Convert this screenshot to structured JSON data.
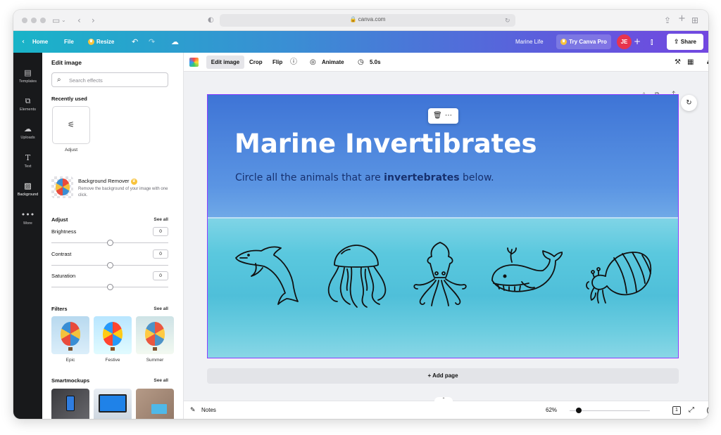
{
  "browser": {
    "url": "canva.com"
  },
  "header": {
    "home_label": "Home",
    "file_label": "File",
    "resize_label": "Resize",
    "project_name": "Marine Life",
    "try_pro_label": "Try Canva Pro",
    "avatar_initials": "JE",
    "share_label": "Share"
  },
  "rail": {
    "items": [
      {
        "label": "Templates"
      },
      {
        "label": "Elements"
      },
      {
        "label": "Uploads"
      },
      {
        "label": "Text"
      },
      {
        "label": "Background"
      },
      {
        "label": "More"
      }
    ]
  },
  "panel": {
    "title": "Edit image",
    "search_placeholder": "Search effects",
    "recently_used_title": "Recently used",
    "recent_item_label": "Adjust",
    "bg_remover_title": "Background Remover",
    "bg_remover_desc": "Remove the background of your image with one click.",
    "adjust_title": "Adjust",
    "adjust_see_all": "See all",
    "sliders": [
      {
        "label": "Brightness",
        "value": "0"
      },
      {
        "label": "Contrast",
        "value": "0"
      },
      {
        "label": "Saturation",
        "value": "0"
      }
    ],
    "filters_title": "Filters",
    "filters_see_all": "See all",
    "filters": [
      {
        "label": "Epic"
      },
      {
        "label": "Festive"
      },
      {
        "label": "Summer"
      }
    ],
    "smartmockups_title": "Smartmockups",
    "smartmockups_see_all": "See all"
  },
  "toolbar": {
    "edit_image_label": "Edit image",
    "crop_label": "Crop",
    "flip_label": "Flip",
    "animate_label": "Animate",
    "duration_label": "5.0s"
  },
  "page": {
    "title": "Marine Invertibrates",
    "subtitle_prefix": "Circle all the animals that are ",
    "subtitle_bold": "invertebrates",
    "subtitle_suffix": " below.",
    "animals": [
      "dolphin-icon",
      "jellyfish-icon",
      "squid-icon",
      "whale-icon",
      "hermit-crab-icon"
    ]
  },
  "canvas": {
    "add_page_label": "+ Add page"
  },
  "bottombar": {
    "notes_label": "Notes",
    "zoom_label": "62%",
    "page_count": "1",
    "help_label": "?"
  },
  "colors": {
    "header_gradient_start": "#19b4c8",
    "header_gradient_end": "#7248e0",
    "selection": "#8b3dff",
    "title_text": "#ffffff",
    "subtitle_text": "#17306e"
  }
}
